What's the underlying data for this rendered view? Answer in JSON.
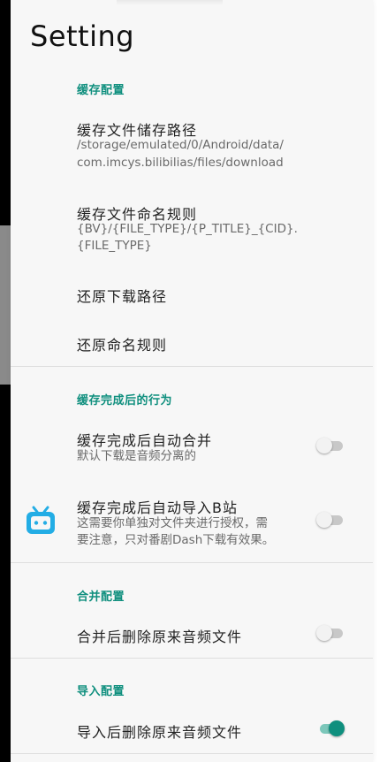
{
  "screen": {
    "title": "Setting"
  },
  "colors": {
    "accent": "#0f8f7e",
    "bili_blue": "#23ade5"
  },
  "sections": {
    "cache_config": {
      "header": "缓存配置",
      "storage_path": {
        "title": "缓存文件储存路径",
        "line1": "/storage/emulated/0/Android/data/",
        "line2": "com.imcys.bilibilias/files/download"
      },
      "naming_rule": {
        "title": "缓存文件命名规则",
        "line1": "{BV}/{FILE_TYPE}/{P_TITLE}_{CID}.",
        "line2": "{FILE_TYPE}"
      },
      "reset_path": {
        "title": "还原下载路径"
      },
      "reset_naming": {
        "title": "还原命名规则"
      }
    },
    "after_cache": {
      "header": "缓存完成后的行为",
      "auto_merge": {
        "title": "缓存完成后自动合并",
        "desc": "默认下载是音频分离的",
        "enabled": false
      },
      "auto_import": {
        "title": "缓存完成后自动导入B站",
        "line1": "这需要你单独对文件夹进行授权，需",
        "line2": "要注意，只对番剧Dash下载有效果。",
        "enabled": false,
        "icon": "bilibili-tv-icon"
      }
    },
    "merge_config": {
      "header": "合并配置",
      "delete_after_merge": {
        "title": "合并后删除原来音频文件",
        "enabled": false
      }
    },
    "import_config": {
      "header": "导入配置",
      "delete_after_import": {
        "title": "导入后删除原来音频文件",
        "enabled": true
      }
    }
  }
}
